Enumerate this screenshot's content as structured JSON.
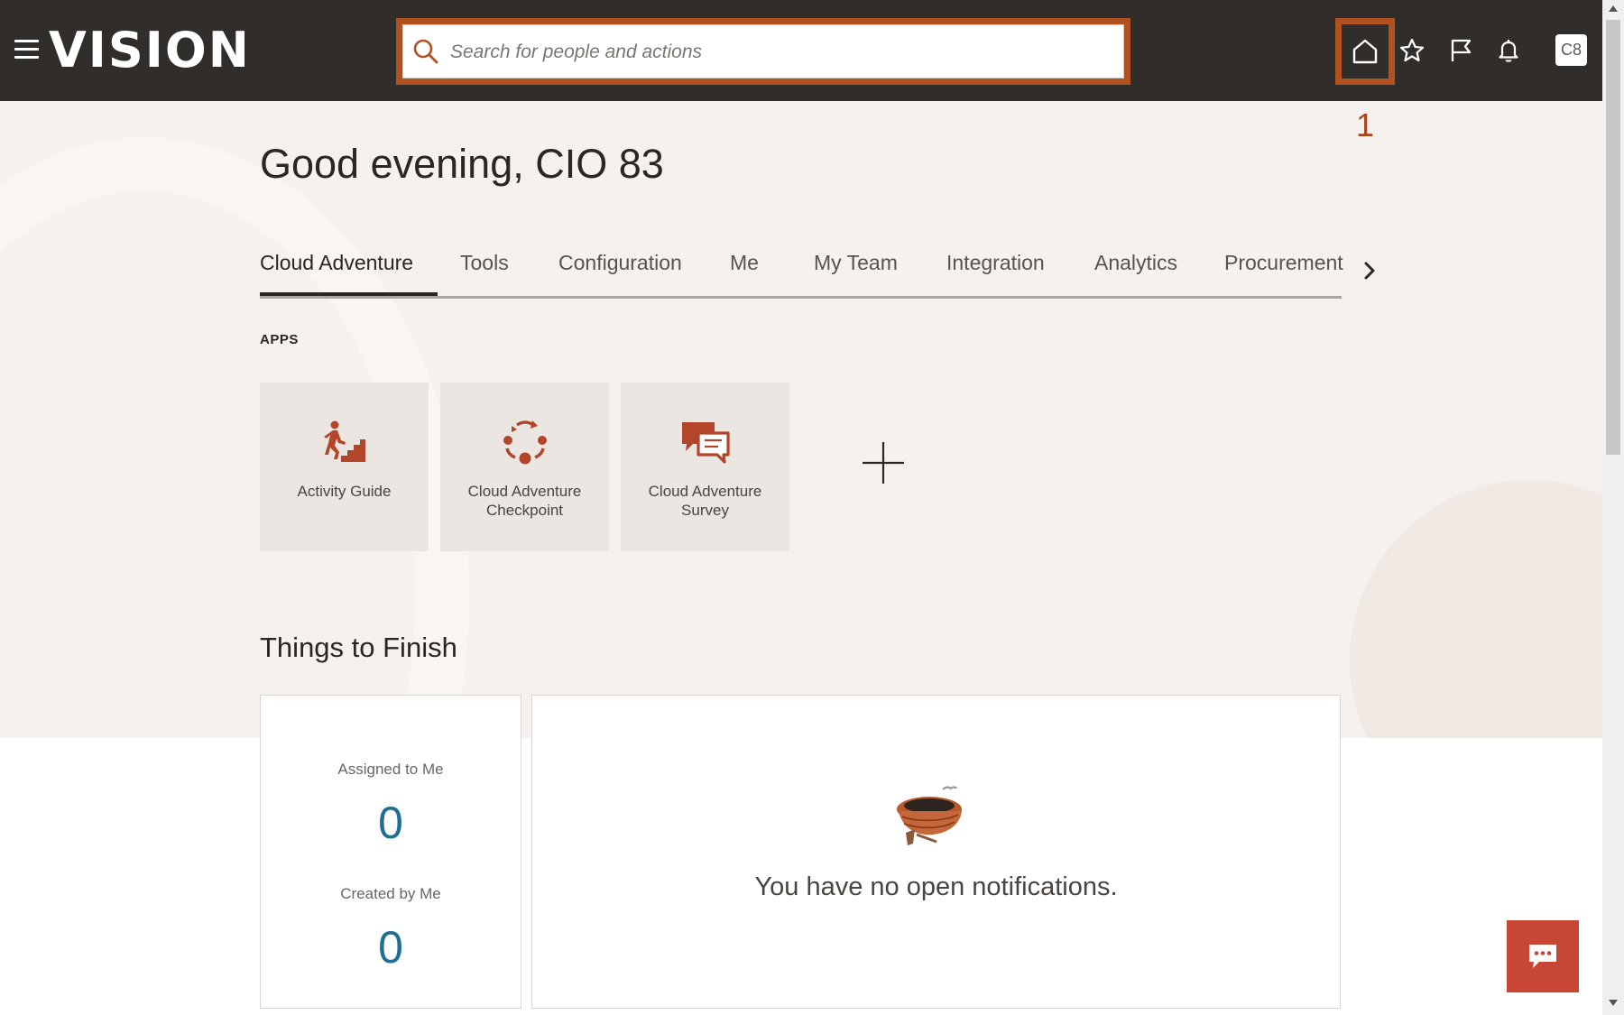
{
  "header": {
    "logo_text": "VISION",
    "search_placeholder": "Search for people and actions",
    "avatar_initials": "C8",
    "callout_number": "1",
    "icons": [
      "hamburger-menu-icon",
      "search-icon",
      "home-icon",
      "star-icon",
      "flag-icon",
      "bell-icon"
    ]
  },
  "greeting": "Good evening, CIO 83",
  "tabs": [
    {
      "label": "Cloud Adventure",
      "active": true
    },
    {
      "label": "Tools"
    },
    {
      "label": "Configuration"
    },
    {
      "label": "Me"
    },
    {
      "label": "My Team"
    },
    {
      "label": "Integration"
    },
    {
      "label": "Analytics"
    },
    {
      "label": "Procurement"
    }
  ],
  "apps": {
    "section_label": "APPS",
    "items": [
      {
        "label": "Activity Guide",
        "icon": "stairs-walker-icon"
      },
      {
        "label": "Cloud Adventure Checkpoint",
        "icon": "cycle-icon"
      },
      {
        "label": "Cloud Adventure Survey",
        "icon": "chat-bubbles-icon"
      }
    ]
  },
  "things_to_finish": {
    "title": "Things to Finish",
    "assigned_label": "Assigned to Me",
    "assigned_count": "0",
    "created_label": "Created by Me",
    "created_count": "0",
    "empty_message": "You have no open notifications."
  },
  "colors": {
    "header_bg": "#312d2a",
    "highlight": "#b0511f",
    "accent_icon": "#b3452b",
    "count_color": "#1f6f95",
    "chat_button": "#c74634"
  }
}
